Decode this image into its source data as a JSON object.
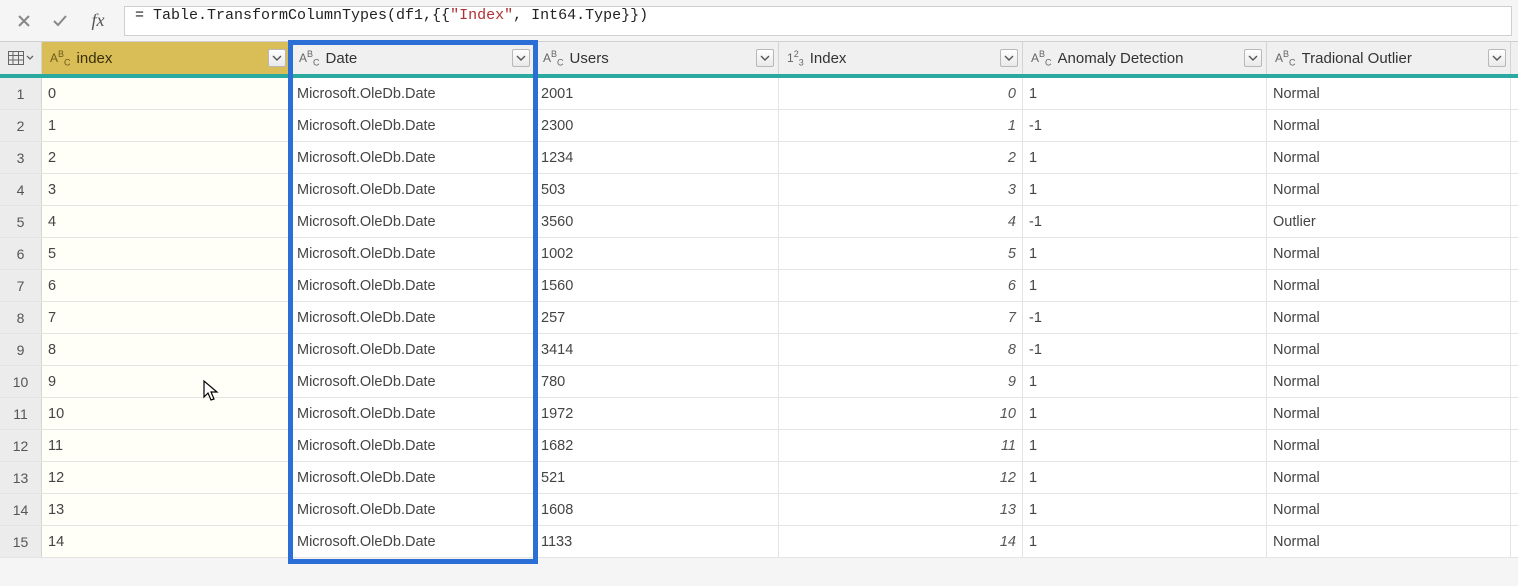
{
  "formula_bar": {
    "fx_label": "fx",
    "formula_prefix": "= Table.TransformColumnTypes(df1,{{",
    "formula_str": "\"Index\"",
    "formula_suffix": ", Int64.Type}})"
  },
  "columns": [
    {
      "key": "index",
      "label": "index",
      "type_icon": "abc",
      "selected": true,
      "width_class": "w-index",
      "align": "left"
    },
    {
      "key": "date",
      "label": "Date",
      "type_icon": "abc",
      "selected": false,
      "width_class": "w-date",
      "align": "left"
    },
    {
      "key": "users",
      "label": "Users",
      "type_icon": "abc",
      "selected": false,
      "width_class": "w-users",
      "align": "left"
    },
    {
      "key": "idx2",
      "label": "Index",
      "type_icon": "123",
      "selected": false,
      "width_class": "w-idx2",
      "align": "right"
    },
    {
      "key": "anom",
      "label": "Anomaly Detection",
      "type_icon": "abc",
      "selected": false,
      "width_class": "w-anom",
      "align": "left"
    },
    {
      "key": "trad",
      "label": "Tradional Outlier",
      "type_icon": "abc",
      "selected": false,
      "width_class": "w-trad",
      "align": "left"
    }
  ],
  "rows": [
    {
      "n": "1",
      "index": "0",
      "date": "Microsoft.OleDb.Date",
      "users": "2001",
      "idx2": "0",
      "anom": "1",
      "trad": "Normal"
    },
    {
      "n": "2",
      "index": "1",
      "date": "Microsoft.OleDb.Date",
      "users": "2300",
      "idx2": "1",
      "anom": "-1",
      "trad": "Normal"
    },
    {
      "n": "3",
      "index": "2",
      "date": "Microsoft.OleDb.Date",
      "users": "1234",
      "idx2": "2",
      "anom": "1",
      "trad": "Normal"
    },
    {
      "n": "4",
      "index": "3",
      "date": "Microsoft.OleDb.Date",
      "users": "503",
      "idx2": "3",
      "anom": "1",
      "trad": "Normal"
    },
    {
      "n": "5",
      "index": "4",
      "date": "Microsoft.OleDb.Date",
      "users": "3560",
      "idx2": "4",
      "anom": "-1",
      "trad": "Outlier"
    },
    {
      "n": "6",
      "index": "5",
      "date": "Microsoft.OleDb.Date",
      "users": "1002",
      "idx2": "5",
      "anom": "1",
      "trad": "Normal"
    },
    {
      "n": "7",
      "index": "6",
      "date": "Microsoft.OleDb.Date",
      "users": "1560",
      "idx2": "6",
      "anom": "1",
      "trad": "Normal"
    },
    {
      "n": "8",
      "index": "7",
      "date": "Microsoft.OleDb.Date",
      "users": "257",
      "idx2": "7",
      "anom": "-1",
      "trad": "Normal"
    },
    {
      "n": "9",
      "index": "8",
      "date": "Microsoft.OleDb.Date",
      "users": "3414",
      "idx2": "8",
      "anom": "-1",
      "trad": "Normal"
    },
    {
      "n": "10",
      "index": "9",
      "date": "Microsoft.OleDb.Date",
      "users": "780",
      "idx2": "9",
      "anom": "1",
      "trad": "Normal"
    },
    {
      "n": "11",
      "index": "10",
      "date": "Microsoft.OleDb.Date",
      "users": "1972",
      "idx2": "10",
      "anom": "1",
      "trad": "Normal"
    },
    {
      "n": "12",
      "index": "11",
      "date": "Microsoft.OleDb.Date",
      "users": "1682",
      "idx2": "11",
      "anom": "1",
      "trad": "Normal"
    },
    {
      "n": "13",
      "index": "12",
      "date": "Microsoft.OleDb.Date",
      "users": "521",
      "idx2": "12",
      "anom": "1",
      "trad": "Normal"
    },
    {
      "n": "14",
      "index": "13",
      "date": "Microsoft.OleDb.Date",
      "users": "1608",
      "idx2": "13",
      "anom": "1",
      "trad": "Normal"
    },
    {
      "n": "15",
      "index": "14",
      "date": "Microsoft.OleDb.Date",
      "users": "1133",
      "idx2": "14",
      "anom": "1",
      "trad": "Normal"
    }
  ],
  "highlight": {
    "column_key": "date"
  }
}
